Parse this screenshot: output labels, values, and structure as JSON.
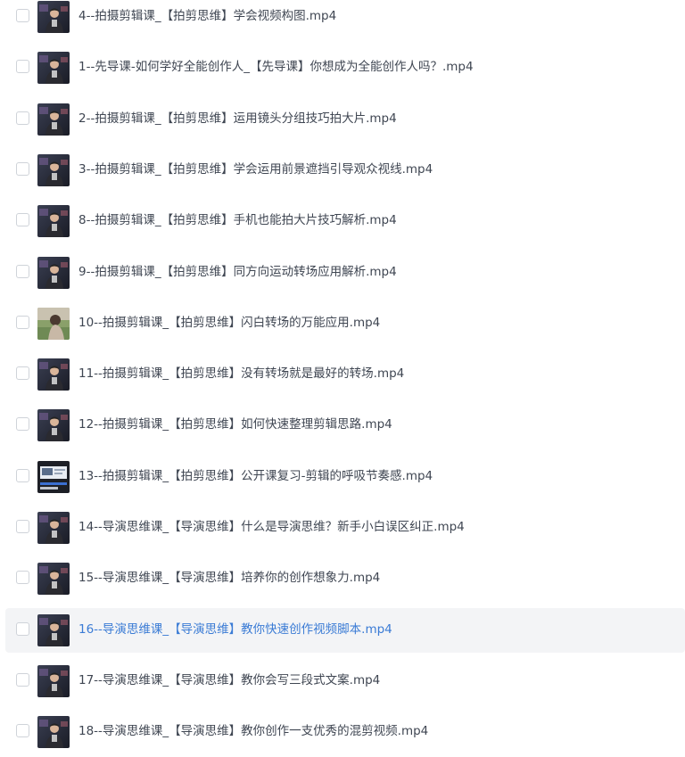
{
  "files": [
    {
      "name": "4--拍摄剪辑课_【拍剪思维】学会视频构图.mp4",
      "thumb": "video-thumbnail",
      "selected": false
    },
    {
      "name": "1--先导课-如何学好全能创作人_【先导课】你想成为全能创作人吗？.mp4",
      "thumb": "video-thumbnail",
      "selected": false
    },
    {
      "name": "2--拍摄剪辑课_【拍剪思维】运用镜头分组技巧拍大片.mp4",
      "thumb": "video-thumbnail",
      "selected": false
    },
    {
      "name": "3--拍摄剪辑课_【拍剪思维】学会运用前景遮挡引导观众视线.mp4",
      "thumb": "video-thumbnail",
      "selected": false
    },
    {
      "name": "8--拍摄剪辑课_【拍剪思维】手机也能拍大片技巧解析.mp4",
      "thumb": "video-thumbnail",
      "selected": false
    },
    {
      "name": "9--拍摄剪辑课_【拍剪思维】同方向运动转场应用解析.mp4",
      "thumb": "video-thumbnail",
      "selected": false
    },
    {
      "name": "10--拍摄剪辑课_【拍剪思维】闪白转场的万能应用.mp4",
      "thumb": "video-thumbnail-outdoor",
      "selected": false
    },
    {
      "name": "11--拍摄剪辑课_【拍剪思维】没有转场就是最好的转场.mp4",
      "thumb": "video-thumbnail",
      "selected": false
    },
    {
      "name": "12--拍摄剪辑课_【拍剪思维】如何快速整理剪辑思路.mp4",
      "thumb": "video-thumbnail",
      "selected": false
    },
    {
      "name": "13--拍摄剪辑课_【拍剪思维】公开课复习-剪辑的呼吸节奏感.mp4",
      "thumb": "video-thumbnail-editor",
      "selected": false
    },
    {
      "name": "14--导演思维课_【导演思维】什么是导演思维？新手小白误区纠正.mp4",
      "thumb": "video-thumbnail",
      "selected": false
    },
    {
      "name": "15--导演思维课_【导演思维】培养你的创作想象力.mp4",
      "thumb": "video-thumbnail",
      "selected": false
    },
    {
      "name": "16--导演思维课_【导演思维】教你快速创作视频脚本.mp4",
      "thumb": "video-thumbnail",
      "selected": true
    },
    {
      "name": "17--导演思维课_【导演思维】教你会写三段式文案.mp4",
      "thumb": "video-thumbnail",
      "selected": false
    },
    {
      "name": "18--导演思维课_【导演思维】教你创作一支优秀的混剪视频.mp4",
      "thumb": "video-thumbnail",
      "selected": false
    }
  ],
  "colors": {
    "text": "#3f4652",
    "selected_text": "#3a7bd5",
    "selected_background": "#f3f4f6",
    "checkbox_border": "#cfd3d9"
  }
}
